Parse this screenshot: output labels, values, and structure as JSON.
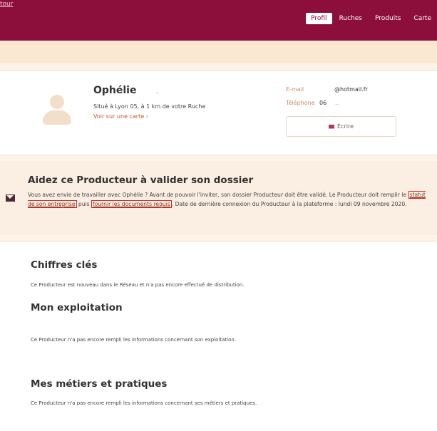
{
  "header": {
    "back_link": "tour",
    "tabs": [
      {
        "label": "Profil",
        "active": true
      },
      {
        "label": "Ruches",
        "active": false
      },
      {
        "label": "Produits",
        "active": false
      },
      {
        "label": "Carte",
        "active": false
      }
    ]
  },
  "profile": {
    "name": "Ophélie",
    "name_suffix": "..",
    "location": "Situé à Lyon 05, à 1 km de votre Ruche",
    "map_link": "Voir sur une carte ›",
    "email_label": "E-mail",
    "email_value": "@hotmail.fr",
    "phone_label": "Téléphone",
    "phone_value": "06",
    "phone_suffix": "..",
    "write_button": "Écrire"
  },
  "alert": {
    "title": "Aidez ce Producteur à valider son dossier",
    "text_1": "Vous avez envie de travailler avec Ophélie ? Avant de pouvoir l'inviter, son dossier Producteur doit être validé. Le Producteur doit remplir le ",
    "link_1": "statut de son entreprise",
    "text_2": " puis ",
    "link_2": "fournir les documents requis",
    "text_3": ". Date de dernière connexion du Producteur à la plateforme : lundi 09 novembre 2020."
  },
  "sections": {
    "key_figures_title": "Chiffres clés",
    "key_figures_text": "Ce Producteur est nouveau dans le Réseau et n'a pas encore effectué de distribution.",
    "farm_title": "Mon exploitation",
    "farm_text": "Ce Producteur n'a pas encore rempli les informations concernant son exploitation.",
    "practices_title": "Mes métiers et pratiques",
    "practices_text": "Ce Producteur n'a pas encore rempli les informations concernant ses métiers et pratiques."
  },
  "colors": {
    "brand": "#8b0f3a",
    "background": "#fdf3e8",
    "highlight_border": "#d42a2a"
  }
}
